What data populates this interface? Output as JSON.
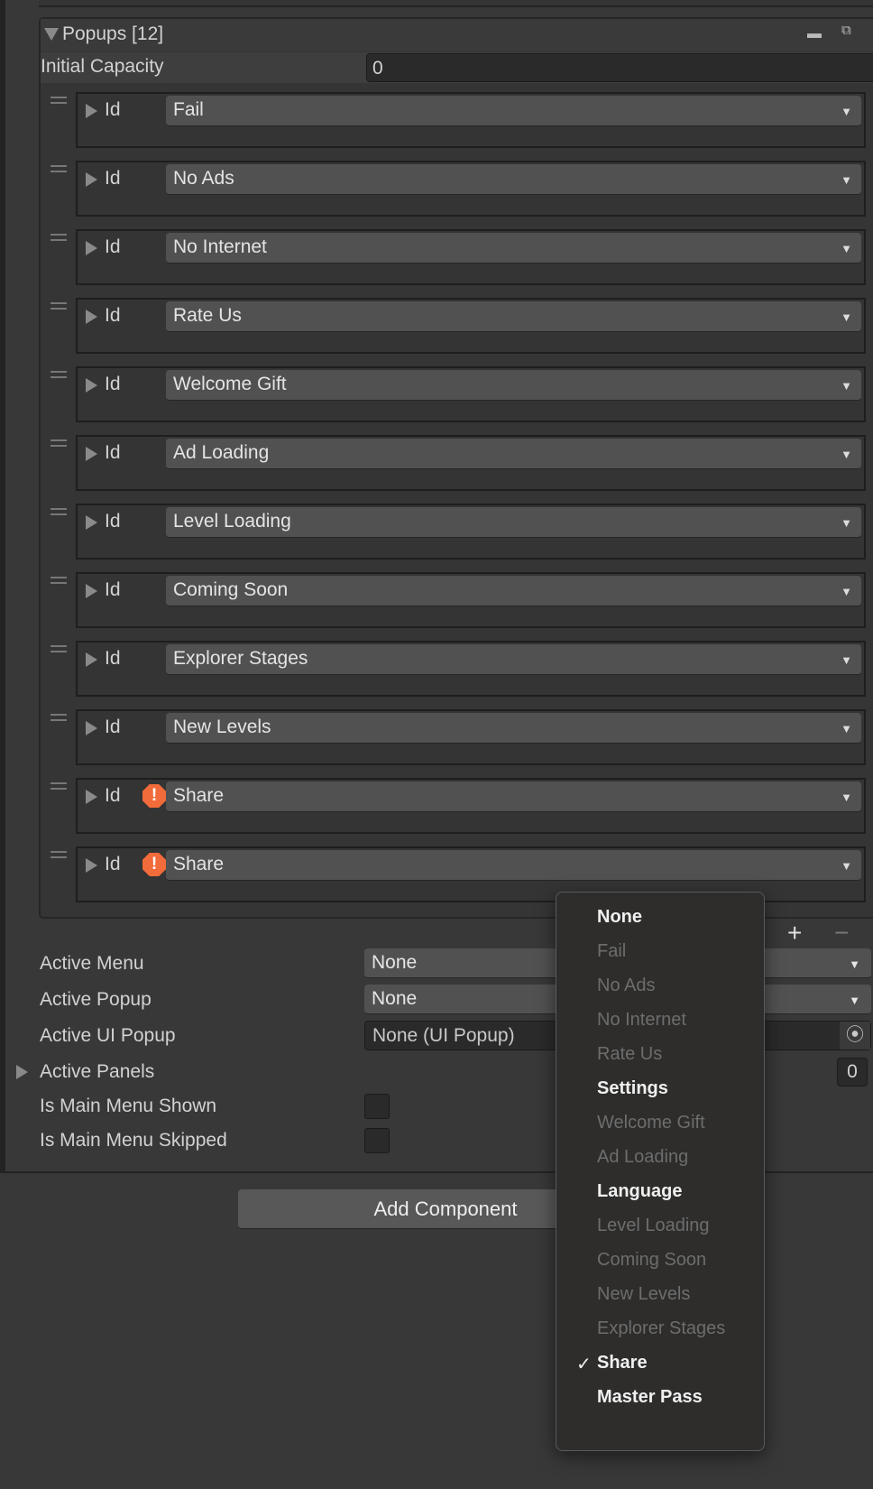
{
  "popups": {
    "title": "Popups [12]",
    "initial_capacity_label": "Initial Capacity",
    "initial_capacity_value": "0",
    "id_label": "Id",
    "items": [
      {
        "value": "Fail",
        "warning": false
      },
      {
        "value": "No Ads",
        "warning": false
      },
      {
        "value": "No Internet",
        "warning": false
      },
      {
        "value": "Rate Us",
        "warning": false
      },
      {
        "value": "Welcome Gift",
        "warning": false
      },
      {
        "value": "Ad Loading",
        "warning": false
      },
      {
        "value": "Level Loading",
        "warning": false
      },
      {
        "value": "Coming Soon",
        "warning": false
      },
      {
        "value": "Explorer Stages",
        "warning": false
      },
      {
        "value": "New Levels",
        "warning": false
      },
      {
        "value": "Share",
        "warning": true
      },
      {
        "value": "Share",
        "warning": true
      }
    ],
    "add": "+",
    "remove": "−",
    "min": "▬",
    "undock": "⧉"
  },
  "fields": {
    "active_menu": {
      "label": "Active Menu",
      "value": "None"
    },
    "active_popup": {
      "label": "Active Popup",
      "value": "None"
    },
    "active_ui_popup": {
      "label": "Active UI Popup",
      "value": "None (UI Popup)"
    },
    "active_panels": {
      "label": "Active Panels",
      "count": "0"
    },
    "main_menu_shown": {
      "label": "Is Main Menu Shown",
      "checked": false
    },
    "main_menu_skipped": {
      "label": "Is Main Menu Skipped",
      "checked": false
    }
  },
  "add_component": "Add Component",
  "menu": {
    "check": "✓",
    "items": [
      {
        "label": "None",
        "enabled": true
      },
      {
        "label": "Fail",
        "enabled": false
      },
      {
        "label": "No Ads",
        "enabled": false
      },
      {
        "label": "No Internet",
        "enabled": false
      },
      {
        "label": "Rate Us",
        "enabled": false
      },
      {
        "label": "Settings",
        "enabled": true
      },
      {
        "label": "Welcome Gift",
        "enabled": false
      },
      {
        "label": "Ad Loading",
        "enabled": false
      },
      {
        "label": "Language",
        "enabled": true
      },
      {
        "label": "Level Loading",
        "enabled": false
      },
      {
        "label": "Coming Soon",
        "enabled": false
      },
      {
        "label": "New Levels",
        "enabled": false
      },
      {
        "label": "Explorer Stages",
        "enabled": false
      },
      {
        "label": "Share",
        "enabled": true,
        "selected": true
      },
      {
        "label": "Master Pass",
        "enabled": true
      }
    ]
  }
}
